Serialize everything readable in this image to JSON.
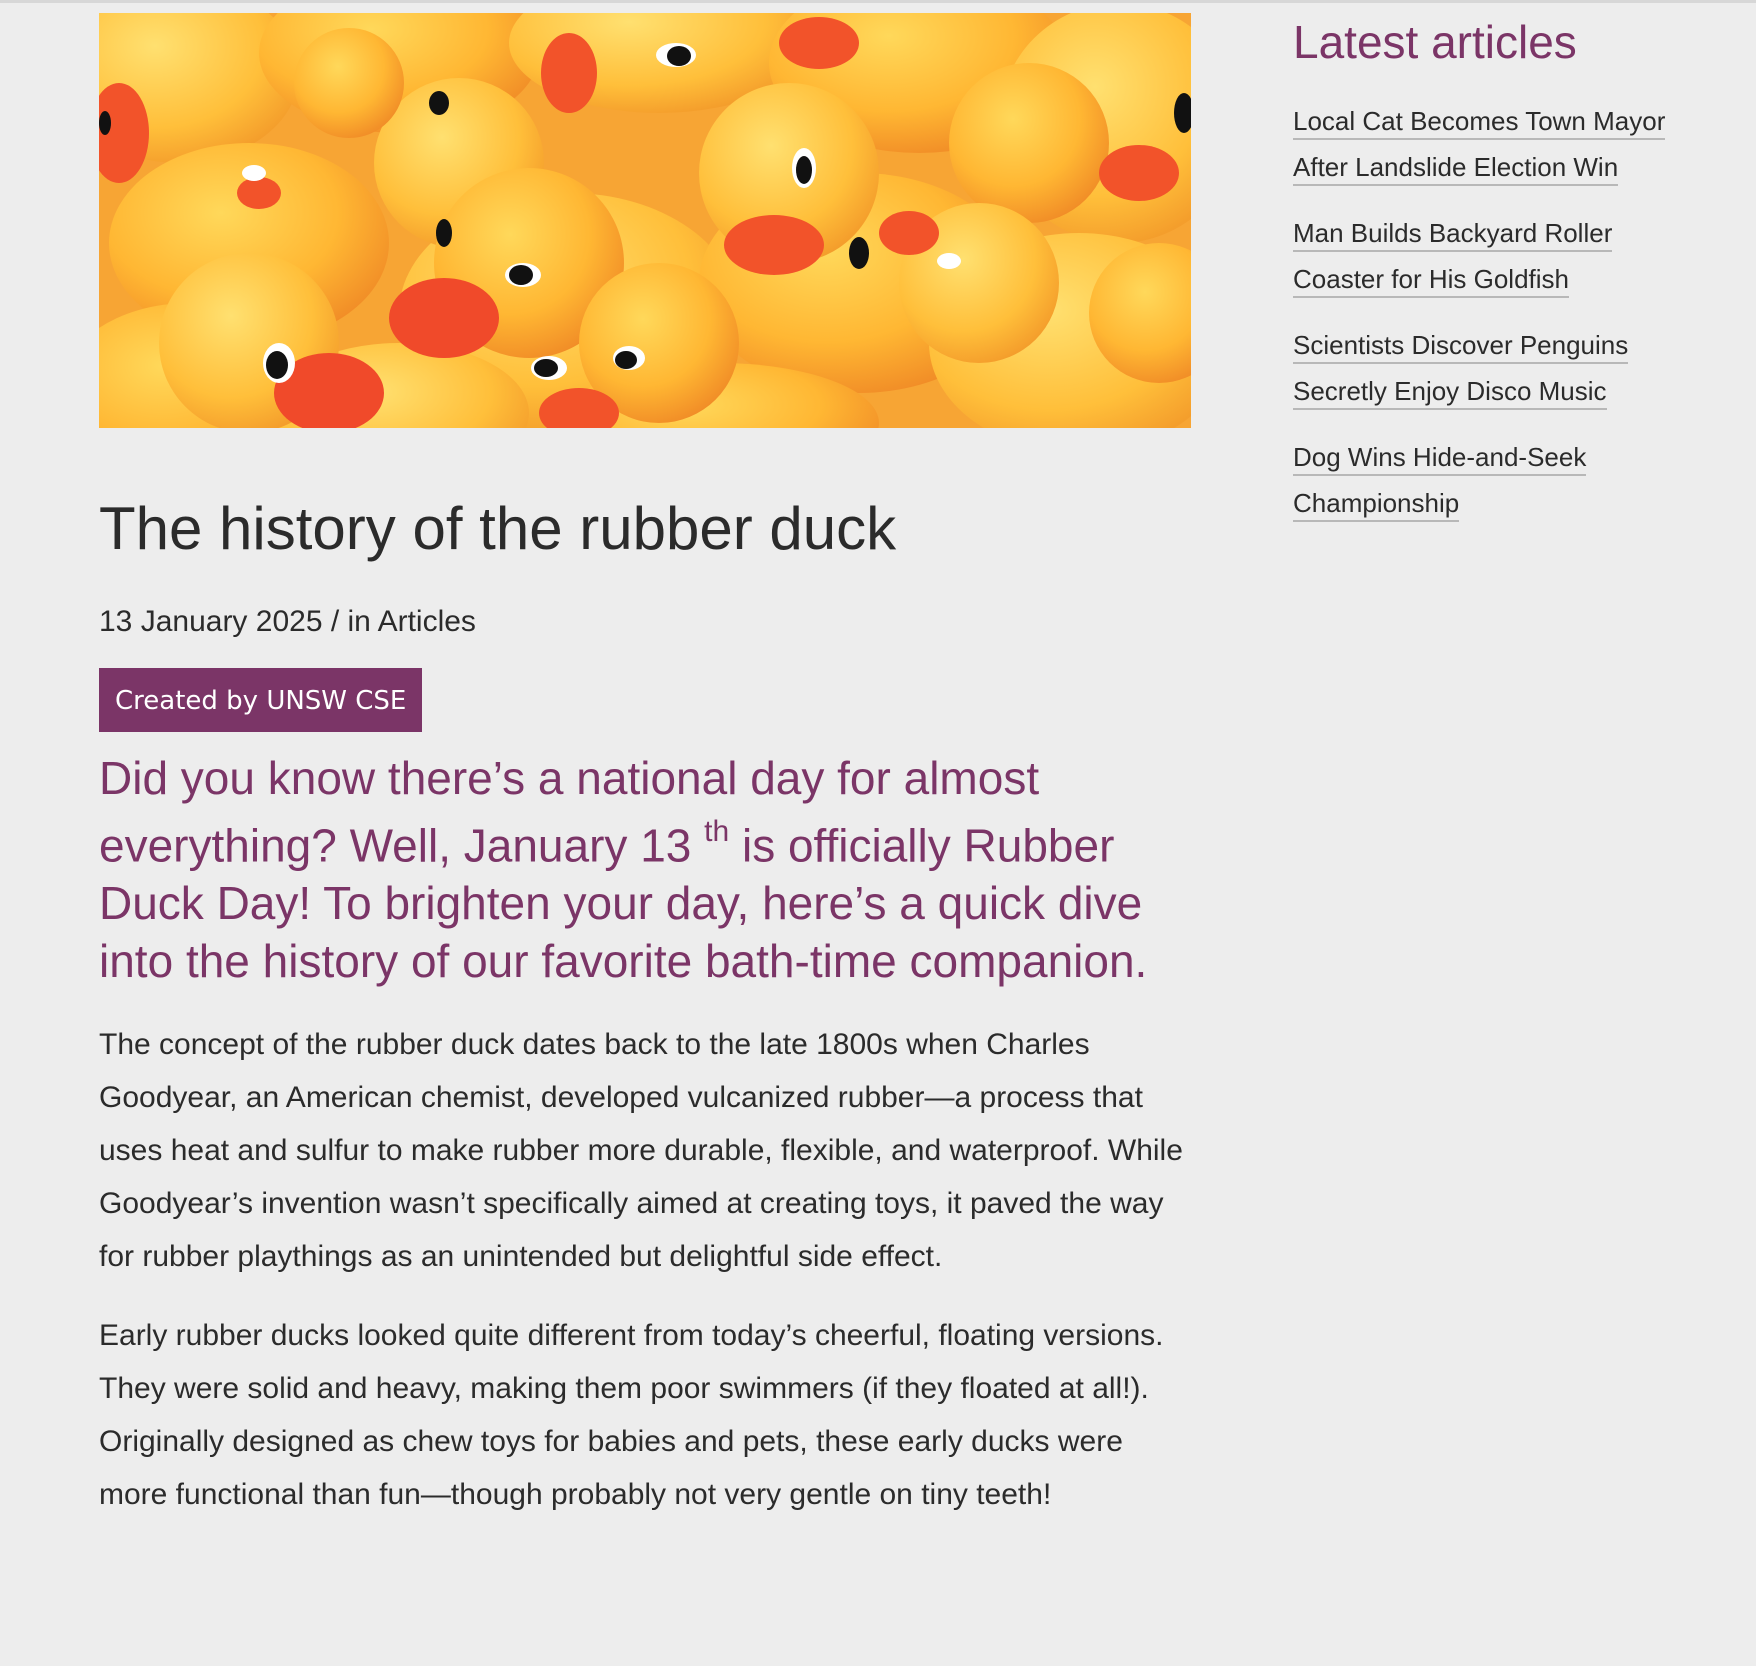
{
  "hero": {
    "image_alt": "Rubber ducks"
  },
  "article": {
    "title": "The history of the rubber duck",
    "date": "13 January 2025",
    "meta_separator": " / in ",
    "category": "Articles",
    "badge": "Created by UNSW CSE",
    "lead_part1": "Did you know there’s a national day for almost everything? Well, January 13 ",
    "lead_sup": "th",
    "lead_part2": " is officially Rubber Duck Day! To brighten your day, here’s a quick dive into the history of our favorite bath-time companion.",
    "paragraphs": [
      "The concept of the rubber duck dates back to the late 1800s when Charles Goodyear, an American chemist, developed vulcanized rubber—a process that uses heat and sulfur to make rubber more durable, flexible, and waterproof. While Goodyear’s invention wasn’t specifically aimed at creating toys, it paved the way for rubber playthings as an unintended but delightful side effect.",
      "Early rubber ducks looked quite different from today’s cheerful, floating versions. They were solid and heavy, making them poor swimmers (if they floated at all!). Originally designed as chew toys for babies and pets, these early ducks were more functional than fun—though probably not very gentle on tiny teeth!"
    ]
  },
  "sidebar": {
    "heading": "Latest articles",
    "items": [
      {
        "label": "Local Cat Becomes Town Mayor After Landslide Election Win"
      },
      {
        "label": "Man Builds Backyard Roller Coaster for His Goldfish"
      },
      {
        "label": "Scientists Discover Penguins Secretly Enjoy Disco Music"
      },
      {
        "label": "Dog Wins Hide-and-Seek Championship"
      }
    ]
  }
}
